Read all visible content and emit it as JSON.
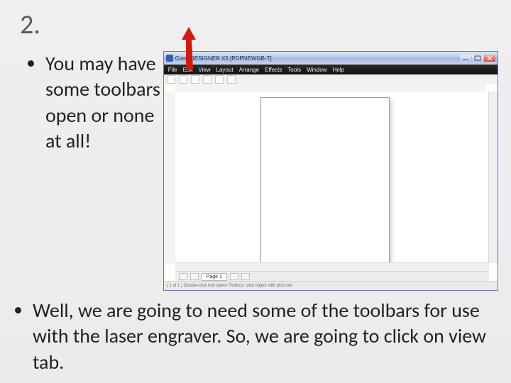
{
  "slide": {
    "step_number": "2.",
    "bullet1": "You may have some toolbars open or none at all!",
    "bullet2": "Well, we are going to need some of the toolbars for use with the laser engraver.  So, we are going to click on view tab."
  },
  "screenshot": {
    "title": "Corel DESIGNER X5  [PDPNEWGB-T]",
    "menu": [
      "File",
      "Edit",
      "View",
      "Layout",
      "Arrange",
      "Effects",
      "Tools",
      "Window",
      "Help"
    ],
    "page_tab": "Page 1",
    "status": "( 1 of 1 )  Double-click tool opens Toolbox; click object with pick tool"
  }
}
